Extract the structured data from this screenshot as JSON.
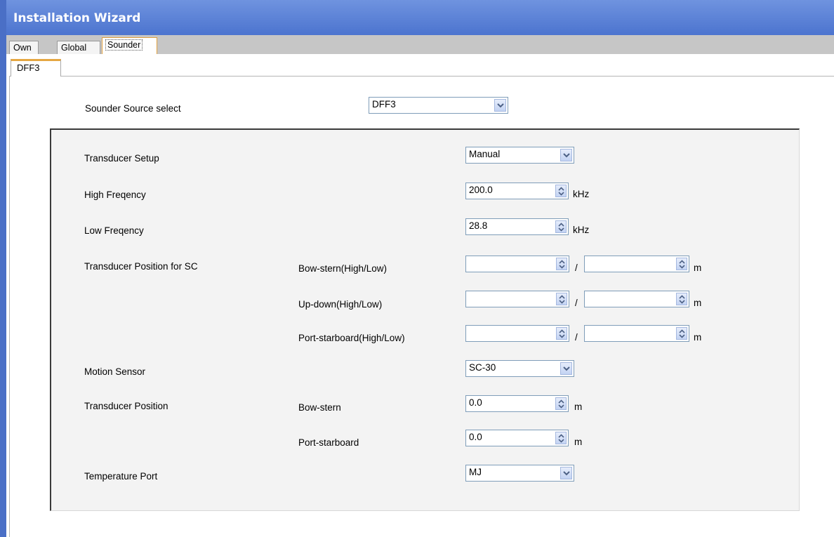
{
  "window": {
    "title": "Installation Wizard"
  },
  "tabs": [
    {
      "label": "Own"
    },
    {
      "label": "Global"
    },
    {
      "label": "Sounder"
    }
  ],
  "subtab": {
    "label": "DFF3"
  },
  "source": {
    "label": "Sounder Source select",
    "value": "DFF3"
  },
  "fields": {
    "transducer_setup": {
      "label": "Transducer Setup",
      "value": "Manual"
    },
    "high_freq": {
      "label": "High Freqency",
      "value": "200.0",
      "unit": "kHz"
    },
    "low_freq": {
      "label": "Low Freqency",
      "value": "28.8",
      "unit": "kHz"
    },
    "sc_position": {
      "label": "Transducer Position for SC",
      "rows": [
        {
          "label": "Bow-stern(High/Low)",
          "high": "",
          "low": "",
          "sep": "/",
          "unit": "m"
        },
        {
          "label": "Up-down(High/Low)",
          "high": "",
          "low": "",
          "sep": "/",
          "unit": "m"
        },
        {
          "label": "Port-starboard(High/Low)",
          "high": "",
          "low": "",
          "sep": "/",
          "unit": "m"
        }
      ]
    },
    "motion_sensor": {
      "label": "Motion Sensor",
      "value": "SC-30"
    },
    "transducer_position": {
      "label": "Transducer Position",
      "bow_stern": {
        "label": "Bow-stern",
        "value": "0.0",
        "unit": "m"
      },
      "port_starboard": {
        "label": "Port-starboard",
        "value": "0.0",
        "unit": "m"
      }
    },
    "temperature_port": {
      "label": "Temperature Port",
      "value": "MJ"
    }
  },
  "icons": {
    "dropdown": "chevron-down-icon",
    "spinner": "spinner-arrows-icon"
  },
  "colors": {
    "titlebar": "#4c74cf",
    "tab_accent": "#e5a742",
    "panel_bg": "#f3f3f3"
  }
}
